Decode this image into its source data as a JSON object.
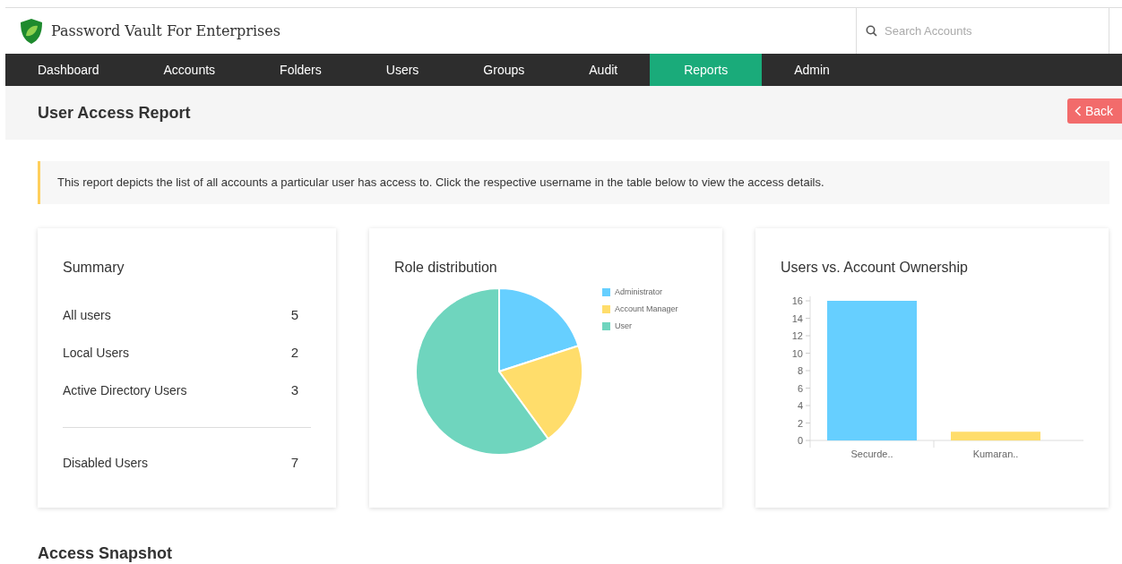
{
  "header": {
    "product_name": "Password Vault For Enterprises",
    "search": {
      "placeholder": "Search Accounts"
    }
  },
  "nav": [
    {
      "label": "Dashboard",
      "selected": false
    },
    {
      "label": "Accounts",
      "selected": false
    },
    {
      "label": "Folders",
      "selected": false
    },
    {
      "label": "Users",
      "selected": false
    },
    {
      "label": "Groups",
      "selected": false
    },
    {
      "label": "Audit",
      "selected": false
    },
    {
      "label": "Reports",
      "selected": true
    },
    {
      "label": "Admin",
      "selected": false
    }
  ],
  "page": {
    "title": "User Access Report",
    "back_button": "Back"
  },
  "info": "This report depicts the list of all accounts a particular user has access to. Click the respective username in the table below to view the access details.",
  "summary": {
    "title": "Summary",
    "rows": [
      {
        "label": "All users",
        "value": "5"
      },
      {
        "label": "Local Users",
        "value": "2"
      },
      {
        "label": "Active Directory Users",
        "value": "3"
      }
    ],
    "footer_rows": [
      {
        "label": "Disabled Users",
        "value": "7"
      }
    ]
  },
  "role_distribution": {
    "title": "Role distribution",
    "chart_data": {
      "type": "pie",
      "categories": [
        "Administrator",
        "Account Manager",
        "User"
      ],
      "values": [
        20,
        20,
        60
      ],
      "legend": "right",
      "colors": [
        "#66cfff",
        "#ffdd6b",
        "#6fd5be"
      ]
    }
  },
  "ownership": {
    "title": "Users vs. Account Ownership",
    "chart_data": {
      "type": "bar",
      "categories": [
        "Securde..",
        "Kumaran.."
      ],
      "series": [
        {
          "values": [
            16,
            1
          ]
        }
      ],
      "colors": [
        "#66cfff",
        "#ffdd6b"
      ],
      "ylim": [
        0,
        16
      ],
      "yticks": [
        0,
        2,
        4,
        6,
        8,
        10,
        12,
        14,
        16
      ]
    }
  },
  "section_title": "Access Snapshot"
}
